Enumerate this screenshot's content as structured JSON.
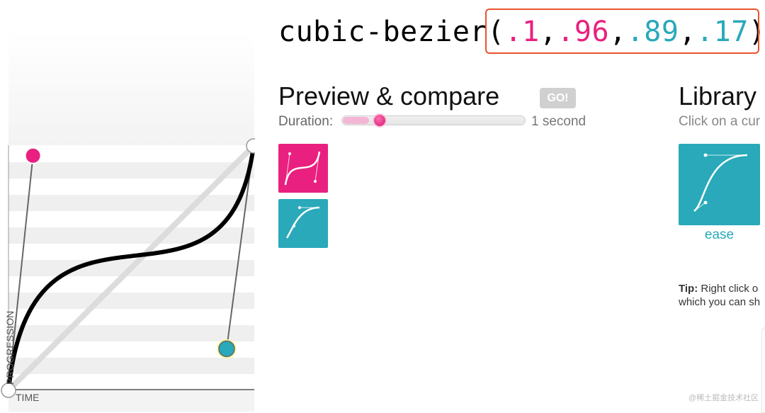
{
  "title": {
    "prefix": "cubic-bezier",
    "open_paren": "(",
    "p1x": ".1",
    "sep1": ",",
    "p1y": ".96",
    "sep2": ",",
    "p2x": ".89",
    "sep3": ",",
    "p2y": ".17",
    "close_paren": ")"
  },
  "editor": {
    "x_axis_label": "TIME",
    "y_axis_label": "PROGRESSION",
    "curve": [
      0.1,
      0.96,
      0.89,
      0.17
    ]
  },
  "preview": {
    "heading": "Preview & compare",
    "go_label": "GO!",
    "duration_label": "Duration:",
    "duration_value": "1 second",
    "duration_fraction": 0.12
  },
  "library": {
    "heading": "Library",
    "subtitle": "Click on a cur",
    "items": [
      {
        "label": "ease"
      }
    ],
    "tip_bold": "Tip:",
    "tip_line1": " Right click o",
    "tip_line2": "which you can sh"
  },
  "watermark": "@稀土掘金技术社区",
  "colors": {
    "pink": "#e9207f",
    "teal": "#29a9ba",
    "highlight_border": "#e8532f",
    "go_button": "#d0d0d0"
  }
}
